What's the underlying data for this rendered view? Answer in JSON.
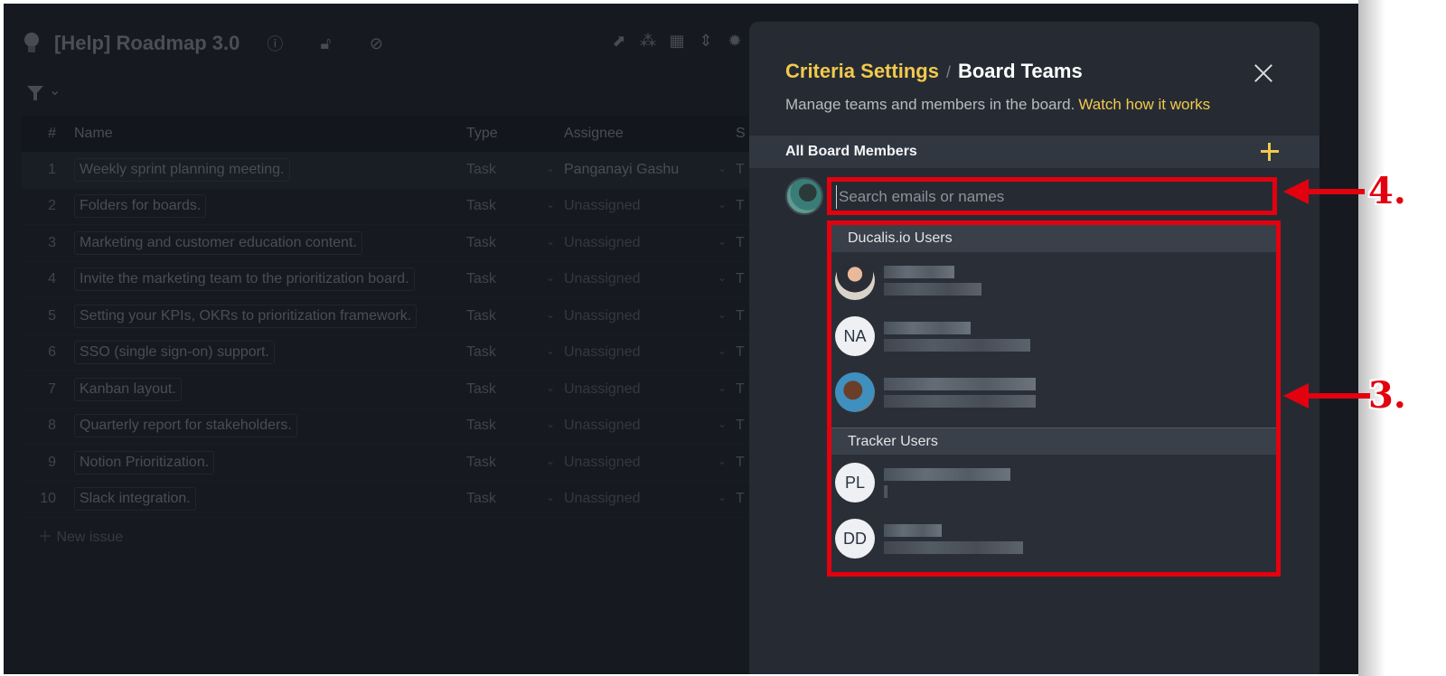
{
  "board": {
    "title": "[Help] Roadmap 3.0",
    "columns": {
      "num": "#",
      "name": "Name",
      "type": "Type",
      "assignee": "Assignee",
      "s": "S"
    },
    "rows": [
      {
        "num": "1",
        "name": "Weekly sprint planning meeting.",
        "type": "Task",
        "assignee": "Panganayi Gashu",
        "s": "T"
      },
      {
        "num": "2",
        "name": "Folders for boards.",
        "type": "Task",
        "assignee": "Unassigned",
        "s": "T"
      },
      {
        "num": "3",
        "name": "Marketing and customer education content.",
        "type": "Task",
        "assignee": "Unassigned",
        "s": "T"
      },
      {
        "num": "4",
        "name": "Invite the marketing team to the prioritization board.",
        "type": "Task",
        "assignee": "Unassigned",
        "s": "T"
      },
      {
        "num": "5",
        "name": "Setting your KPIs, OKRs to prioritization framework.",
        "type": "Task",
        "assignee": "Unassigned",
        "s": "T"
      },
      {
        "num": "6",
        "name": "SSO (single sign-on) support.",
        "type": "Task",
        "assignee": "Unassigned",
        "s": "T"
      },
      {
        "num": "7",
        "name": "Kanban layout.",
        "type": "Task",
        "assignee": "Unassigned",
        "s": "T"
      },
      {
        "num": "8",
        "name": "Quarterly report for stakeholders.",
        "type": "Task",
        "assignee": "Unassigned",
        "s": "T"
      },
      {
        "num": "9",
        "name": "Notion Prioritization.",
        "type": "Task",
        "assignee": "Unassigned",
        "s": "T"
      },
      {
        "num": "10",
        "name": "Slack integration.",
        "type": "Task",
        "assignee": "Unassigned",
        "s": "T"
      }
    ],
    "new_issue": "New issue"
  },
  "panel": {
    "breadcrumb_parent": "Criteria Settings",
    "breadcrumb_sep": "/",
    "breadcrumb_current": "Board Teams",
    "subtitle": "Manage teams and members in the board.",
    "subtitle_link": "Watch how it works",
    "members_label": "All Board Members",
    "search": {
      "placeholder": "Search emails or names",
      "value": ""
    },
    "groups": [
      {
        "label": "Ducalis.io Users",
        "users": [
          {
            "initials": ""
          },
          {
            "initials": "NA"
          },
          {
            "initials": ""
          }
        ]
      },
      {
        "label": "Tracker Users",
        "users": [
          {
            "initials": "PL"
          },
          {
            "initials": "DD"
          }
        ]
      }
    ]
  },
  "callouts": {
    "search": "4.",
    "dropdown": "3."
  },
  "colors": {
    "accent": "#f2c94c",
    "highlight": "#e3000f",
    "panel_bg": "#262b33"
  }
}
